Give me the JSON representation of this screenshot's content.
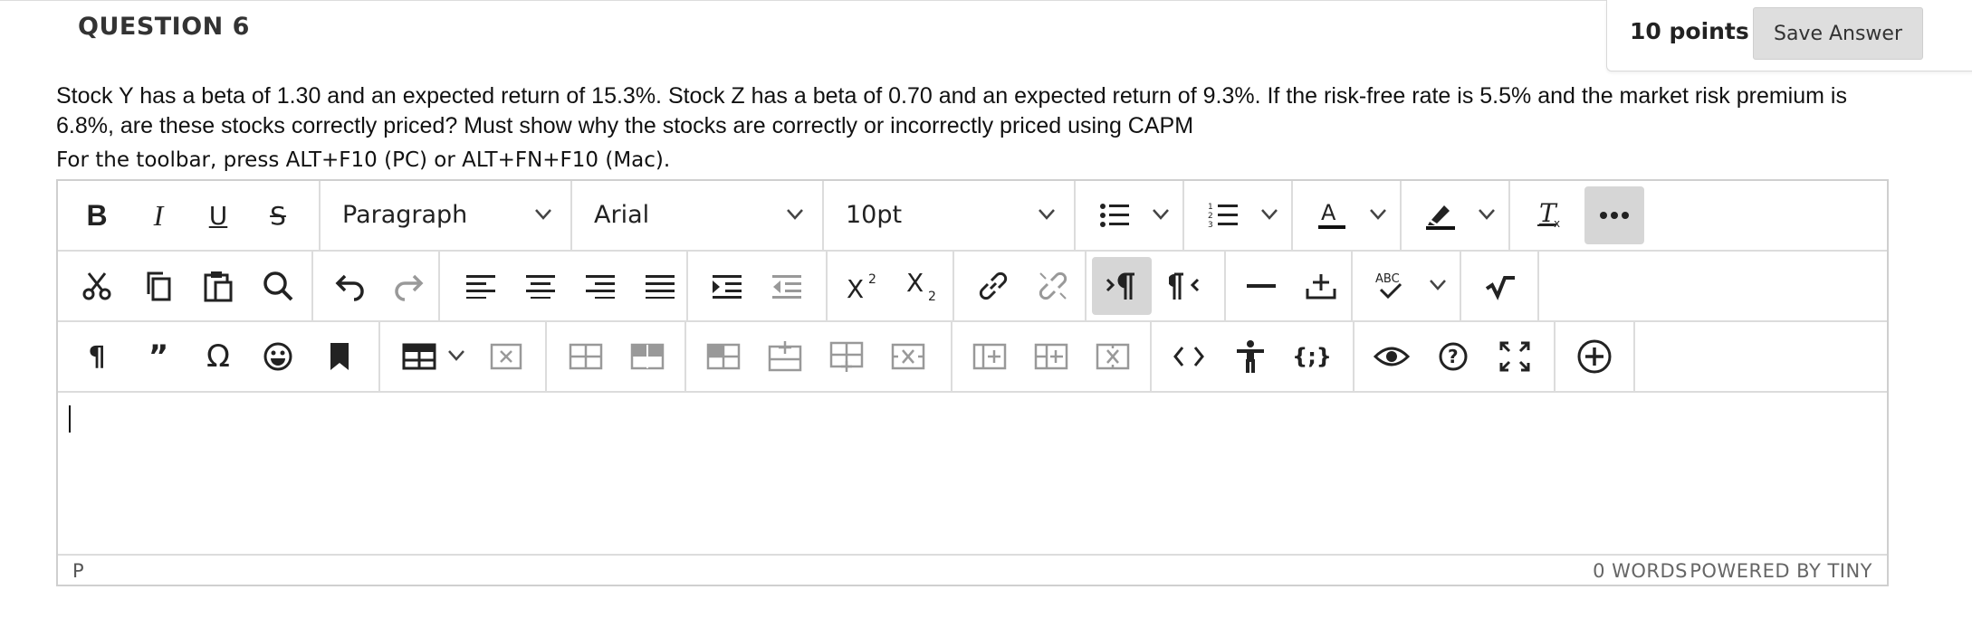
{
  "question": {
    "title": "QUESTION 6",
    "points": "10 points",
    "save_label": "Save Answer",
    "text": "Stock Y has a beta of 1.30 and an expected return of 15.3%. Stock Z has a beta of 0.70 and an expected return of 9.3%. If the risk-free rate is 5.5% and the market risk premium is 6.8%, are these stocks correctly priced?  Must show why the stocks are correctly or incorrectly priced using CAPM",
    "toolbar_hint": "For the toolbar, press ALT+F10 (PC) or ALT+FN+F10 (Mac)."
  },
  "editor": {
    "block_format": "Paragraph",
    "font_family": "Arial",
    "font_size": "10pt",
    "spellcheck_label": "ABC",
    "status_path": "P",
    "word_count": "0 WORDS",
    "powered_by": "POWERED BY TINY",
    "content": ""
  },
  "icons": {
    "row1": [
      "bold-icon",
      "italic-icon",
      "underline-icon",
      "strikethrough-icon",
      "bullet-list-icon",
      "numbered-list-icon",
      "text-color-icon",
      "highlight-color-icon",
      "clear-formatting-icon",
      "more-icon"
    ],
    "row2": [
      "cut-icon",
      "copy-icon",
      "paste-icon",
      "find-icon",
      "undo-icon",
      "redo-icon",
      "align-left-icon",
      "align-center-icon",
      "align-right-icon",
      "justify-icon",
      "indent-icon",
      "outdent-icon",
      "superscript-icon",
      "subscript-icon",
      "link-icon",
      "unlink-icon",
      "ltr-icon",
      "rtl-icon",
      "horizontal-line-icon",
      "insert-anchor-icon",
      "spellcheck-icon",
      "math-icon"
    ],
    "row3": [
      "show-blocks-icon",
      "blockquote-icon",
      "special-character-icon",
      "emoji-icon",
      "bookmark-icon",
      "table-icon",
      "delete-table-icon",
      "table-row-before-icon",
      "table-row-after-icon",
      "cell-props-icon",
      "insert-row-icon",
      "insert-col-icon",
      "delete-cell-icon",
      "split-cell-icon",
      "merge-cell-icon",
      "delete-col-icon",
      "source-code-icon",
      "accessibility-icon",
      "code-sample-icon",
      "preview-icon",
      "help-icon",
      "fullscreen-icon",
      "add-content-icon"
    ]
  },
  "colors": {
    "accent_text": "#222222",
    "border": "#cfcfcf",
    "button_bg": "#dedede",
    "active_bg": "#d6d6d6"
  }
}
